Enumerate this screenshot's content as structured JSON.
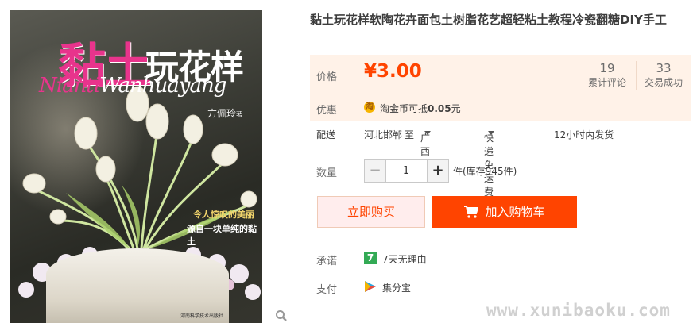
{
  "cover": {
    "title_pink": "黏土",
    "title_white": "玩花样",
    "script_pink": "Nianti",
    "script_white": "Wanhuayang",
    "author": "方佩玲",
    "author_suffix": "著",
    "slogan_line1": "令人惊叹的美丽",
    "slogan_line2": "源自一块单纯的黏土",
    "publisher": "河南科学技术出版社"
  },
  "product": {
    "title": "黏土玩花样软陶花卉面包土树脂花艺超轻粘土教程冷瓷翻糖DIY手工"
  },
  "price": {
    "label": "价格",
    "currency": "¥",
    "value": "3.00",
    "reviews_count": "19",
    "reviews_label": "累计评论",
    "sold_count": "33",
    "sold_label": "交易成功"
  },
  "discount": {
    "label": "优惠",
    "coin_glyph": "淘",
    "text_prefix": "淘金币可抵",
    "amount": "0.05",
    "unit": "元"
  },
  "delivery": {
    "label": "配送",
    "from": "河北邯郸",
    "to_word": "至",
    "destination": "广西柳州",
    "shipping": "快递 免运费",
    "dispatch": "12小时内发货"
  },
  "quantity": {
    "label": "数量",
    "minus": "−",
    "plus": "+",
    "value": "1",
    "stock": "件(库存945件)"
  },
  "actions": {
    "buy_now": "立即购买",
    "add_to_cart": "加入购物车"
  },
  "promise": {
    "label": "承诺",
    "badge": "7",
    "text": "7天无理由"
  },
  "payment": {
    "label": "支付",
    "text": "集分宝"
  },
  "watermark": "www.xunibaoku.com",
  "colors": {
    "accent": "#ff4400",
    "price_bg": "#fff2e8",
    "buy_bg": "#ffeded"
  }
}
